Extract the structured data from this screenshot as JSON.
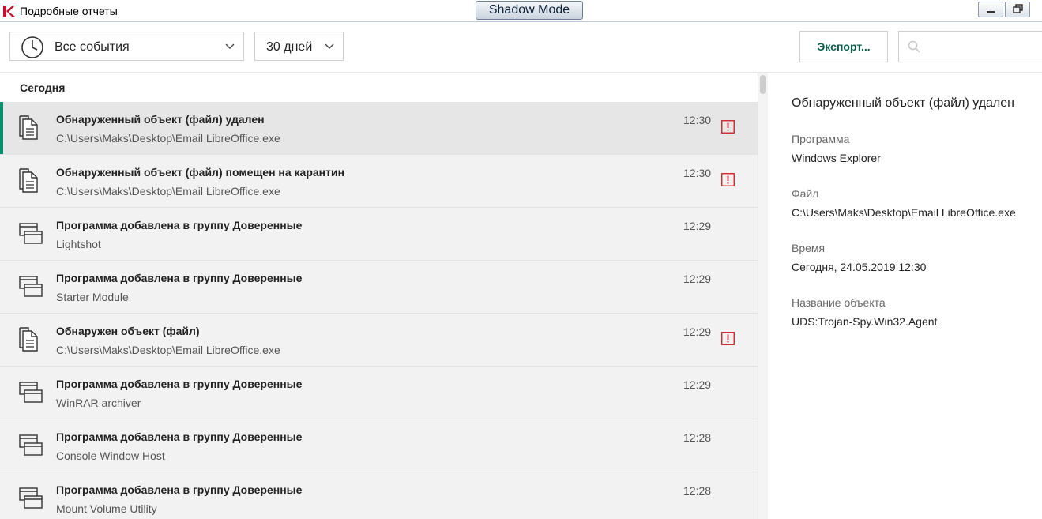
{
  "window": {
    "title": "Подробные отчеты",
    "shadow_mode": "Shadow Mode"
  },
  "toolbar": {
    "events_filter": "Все события",
    "period_filter": "30 дней",
    "export_label": "Экспорт...",
    "search_value": ""
  },
  "list": {
    "group_header": "Сегодня",
    "rows": [
      {
        "title": "Обнаруженный объект (файл) удален",
        "subtitle": "C:\\Users\\Maks\\Desktop\\Email LibreOffice.exe",
        "time": "12:30",
        "icon": "document-icon",
        "alert": true,
        "selected": true
      },
      {
        "title": "Обнаруженный объект (файл) помещен на карантин",
        "subtitle": "C:\\Users\\Maks\\Desktop\\Email LibreOffice.exe",
        "time": "12:30",
        "icon": "document-icon",
        "alert": true,
        "selected": false
      },
      {
        "title": "Программа добавлена в группу Доверенные",
        "subtitle": "Lightshot",
        "time": "12:29",
        "icon": "window-icon",
        "alert": false,
        "selected": false
      },
      {
        "title": "Программа добавлена в группу Доверенные",
        "subtitle": "Starter Module",
        "time": "12:29",
        "icon": "window-icon",
        "alert": false,
        "selected": false
      },
      {
        "title": "Обнаружен объект (файл)",
        "subtitle": "C:\\Users\\Maks\\Desktop\\Email LibreOffice.exe",
        "time": "12:29",
        "icon": "document-icon",
        "alert": true,
        "selected": false
      },
      {
        "title": "Программа добавлена в группу Доверенные",
        "subtitle": "WinRAR archiver",
        "time": "12:29",
        "icon": "window-icon",
        "alert": false,
        "selected": false
      },
      {
        "title": "Программа добавлена в группу Доверенные",
        "subtitle": "Console Window Host",
        "time": "12:28",
        "icon": "window-icon",
        "alert": false,
        "selected": false
      },
      {
        "title": "Программа добавлена в группу Доверенные",
        "subtitle": "Mount Volume Utility",
        "time": "12:28",
        "icon": "window-icon",
        "alert": false,
        "selected": false
      }
    ]
  },
  "details": {
    "title": "Обнаруженный объект (файл) удален",
    "fields": [
      {
        "label": "Программа",
        "value": "Windows Explorer"
      },
      {
        "label": "Файл",
        "value": "C:\\Users\\Maks\\Desktop\\Email LibreOffice.exe"
      },
      {
        "label": "Время",
        "value": "Сегодня, 24.05.2019 12:30"
      },
      {
        "label": "Название объекта",
        "value": "UDS:Trojan-Spy.Win32.Agent"
      }
    ]
  },
  "colors": {
    "accent": "#0a8f6d",
    "alert": "#d0252a",
    "selected_row": "#e6e6e6",
    "row": "#f2f2f2"
  }
}
